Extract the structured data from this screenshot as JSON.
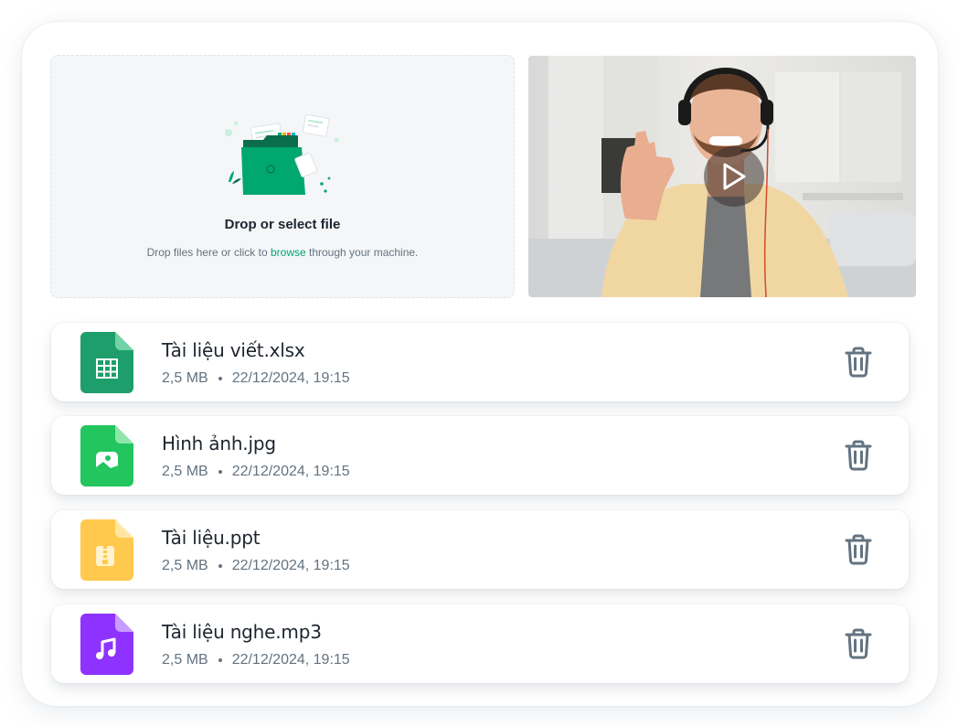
{
  "upload": {
    "title": "Drop or select file",
    "description_prefix": "Drop files here or click to ",
    "link_text": "browse",
    "description_suffix": " through your machine.",
    "accent_color": "#00a76f"
  },
  "video": {
    "play_icon": "play-icon"
  },
  "files": [
    {
      "name": "Tài liệu viết.xlsx",
      "size": "2,5 MB",
      "date": "22/12/2024, 19:15",
      "icon": "spreadsheet-icon",
      "color": "#1e9e6a"
    },
    {
      "name": "Hình ảnh.jpg",
      "size": "2,5 MB",
      "date": "22/12/2024, 19:15",
      "icon": "image-icon",
      "color": "#22c55e"
    },
    {
      "name": "Tài liệu.ppt",
      "size": "2,5 MB",
      "date": "22/12/2024, 19:15",
      "icon": "zip-icon",
      "color": "#ffc94d"
    },
    {
      "name": "Tài liệu nghe.mp3",
      "size": "2,5 MB",
      "date": "22/12/2024, 19:15",
      "icon": "music-icon",
      "color": "#8e33ff"
    }
  ],
  "actions": {
    "delete_icon": "trash-icon"
  }
}
